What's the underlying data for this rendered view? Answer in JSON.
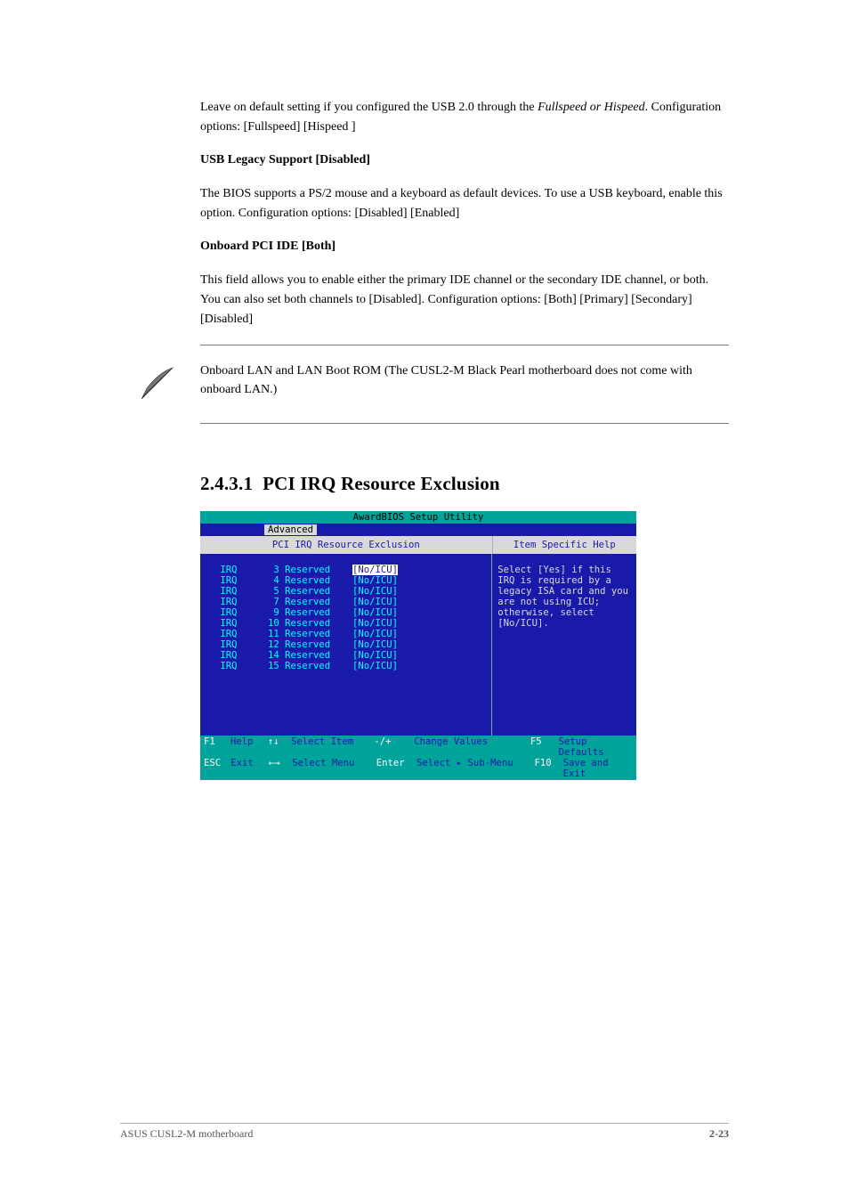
{
  "body": {
    "p1_a": "Leave on default setting if you configured the USB 2.0 through the",
    "p1_b": "Fullspeed or Hispeed",
    "p1_c": ". Configuration options:",
    "p1_opts": "[Fullspeed] [Hispeed ]",
    "h_disable": "USB Legacy Support [Disabled]",
    "p2": "The BIOS supports a PS/2 mouse and a keyboard as default devices. To use a USB keyboard, enable this option. Configuration options: [Disabled] [Enabled]",
    "h_onboard": "Onboard PCI IDE [Both]",
    "p3": "This field allows you to enable either the primary IDE channel or the secondary IDE channel, or both. You can also set both channels to [Disabled]. Configuration options: [Both] [Primary] [Secondary] [Disabled]",
    "note": "Onboard LAN and LAN Boot ROM (The CUSL2-M Black Pearl motherboard does not come with onboard LAN.)"
  },
  "section": {
    "number": "2.4.3.1",
    "title": "PCI IRQ Resource Exclusion"
  },
  "bios": {
    "title": "AwardBIOS Setup Utility",
    "tab": "Advanced",
    "header_left": "PCI IRQ Resource Exclusion",
    "header_right": "Item Specific Help",
    "irqs": [
      {
        "n": "3",
        "lbl": "Reserved",
        "v": "[No/ICU]",
        "sel": true
      },
      {
        "n": "4",
        "lbl": "Reserved",
        "v": "[No/ICU]",
        "sel": false
      },
      {
        "n": "5",
        "lbl": "Reserved",
        "v": "[No/ICU]",
        "sel": false
      },
      {
        "n": "7",
        "lbl": "Reserved",
        "v": "[No/ICU]",
        "sel": false
      },
      {
        "n": "9",
        "lbl": "Reserved",
        "v": "[No/ICU]",
        "sel": false
      },
      {
        "n": "10",
        "lbl": "Reserved",
        "v": "[No/ICU]",
        "sel": false
      },
      {
        "n": "11",
        "lbl": "Reserved",
        "v": "[No/ICU]",
        "sel": false
      },
      {
        "n": "12",
        "lbl": "Reserved",
        "v": "[No/ICU]",
        "sel": false
      },
      {
        "n": "14",
        "lbl": "Reserved",
        "v": "[No/ICU]",
        "sel": false
      },
      {
        "n": "15",
        "lbl": "Reserved",
        "v": "[No/ICU]",
        "sel": false
      }
    ],
    "help": "Select [Yes] if this IRQ is required by a legacy ISA card and you are not using ICU; otherwise, select [No/ICU].",
    "footer": {
      "f1": "F1",
      "help": "Help",
      "updn": "↑↓",
      "selitem": "Select Item",
      "pm": "-/+",
      "chval": "Change Values",
      "f5": "F5",
      "setup": "Setup Defaults",
      "esc": "ESC",
      "exit": "Exit",
      "lr": "←→",
      "selmenu": "Select Menu",
      "enter": "Enter",
      "sub": "Select ▸ Sub-Menu",
      "f10": "F10",
      "save": "Save and Exit"
    }
  },
  "pagefoot": {
    "left": "ASUS CUSL2-M motherboard",
    "right": "2-23"
  }
}
